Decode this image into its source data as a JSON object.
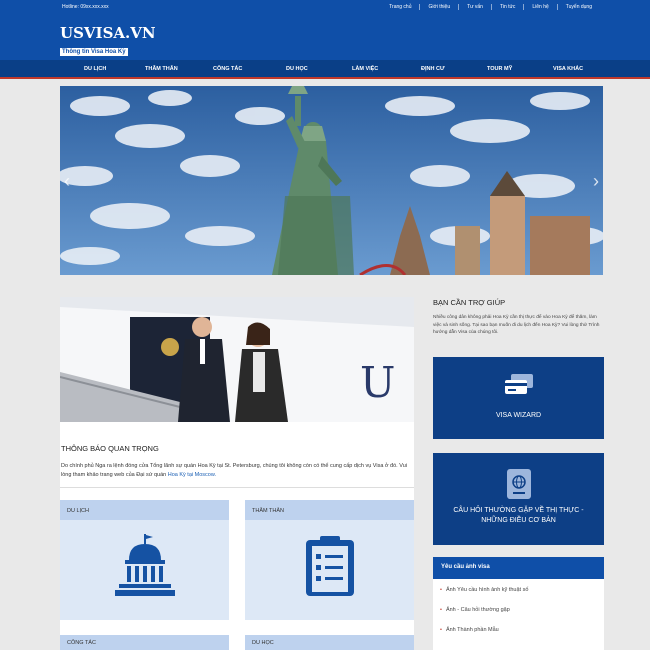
{
  "header": {
    "hotline": "Hotline: 09xx.xxx.xxx",
    "topnav": [
      "Trang chủ",
      "Giới thiệu",
      "Tư vấn",
      "Tin tức",
      "Liên hệ",
      "Tuyển dụng"
    ],
    "logo_main": "USVISA.VN",
    "logo_sub": "Thông tin Visa Hoa Kỳ"
  },
  "mainnav": [
    "DU LỊCH",
    "THĂM THÂN",
    "CÔNG TÁC",
    "DU HỌC",
    "LÀM VIỆC",
    "ĐỊNH CƯ",
    "TOUR MỸ",
    "VISA KHÁC"
  ],
  "banner": {
    "prev_icon": "‹",
    "next_icon": "›"
  },
  "notice": {
    "title": "THÔNG BÁO QUAN TRỌNG",
    "text": "Do chính phủ Nga ra lệnh đóng cửa Tổng lãnh sự quán Hoa Kỳ tại St. Petersburg, chúng tôi không còn có thể cung cấp dịch vụ Visa ở đó. Vui lòng tham khảo trang web của Đại sứ quán",
    "link": "Hoa Kỳ tại Moscow."
  },
  "cards": [
    {
      "label": "DU LỊCH",
      "icon": "capitol-icon"
    },
    {
      "label": "THĂM THÂN",
      "icon": "clipboard-icon"
    },
    {
      "label": "CÔNG TÁC"
    },
    {
      "label": "DU HỌC"
    }
  ],
  "sidebar": {
    "help_title": "BẠN CẦN TRỢ GIÚP",
    "help_text": "Nhiều công dân không phải Hoa Kỳ cần thị thực để vào Hoa Kỳ để thăm, làm việc và sinh sống. Tại sao bạn muốn đi du lịch đến Hoa Kỳ? Vui lòng thử Trình hướng dẫn Visa của chúng tôi.",
    "wizard_label": "VISA WIZARD",
    "faq_label_1": "CÂU HỎI THƯỜNG GẶP VỀ THỊ THỰC -",
    "faq_label_2": "NHỮNG ĐIỀU CƠ BẢN",
    "req_title": "Yêu cầu ảnh visa",
    "req_items": [
      "Ảnh Yêu cầu hình ảnh kỹ thuật số",
      "Ảnh - Câu hỏi thường gặp",
      "Ảnh Thành phần Mẫu"
    ]
  }
}
